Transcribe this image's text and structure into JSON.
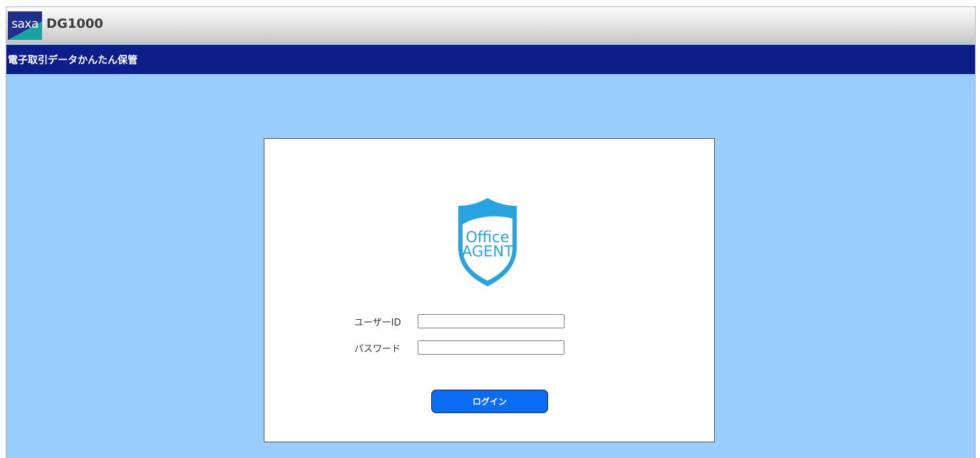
{
  "header": {
    "logo_text": "saxa",
    "product_name": "DG1000"
  },
  "nav": {
    "title": "電子取引データかんたん保管"
  },
  "login": {
    "brand_line1": "Office",
    "brand_line2": "AGENT",
    "user_id_label": "ユーザーID",
    "user_id_value": "",
    "password_label": "パスワード",
    "password_value": "",
    "login_button": "ログイン"
  },
  "colors": {
    "page_bg": "#99ccff",
    "navbar_bg": "#0d1e8a",
    "logo_dark": "#1f2f8a",
    "logo_teal": "#1aa3a0",
    "brand_blue": "#29a3df",
    "button_blue": "#0a6cf2"
  }
}
